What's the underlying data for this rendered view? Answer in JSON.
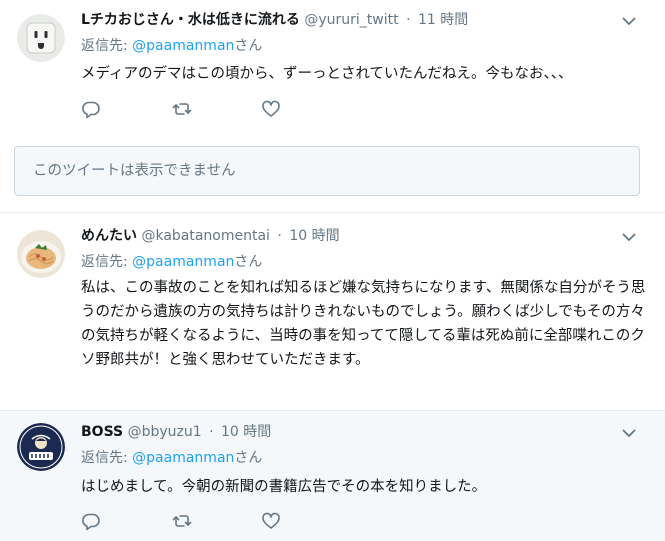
{
  "tweets": [
    {
      "name": "Lチカおじさん・水は低きに流れる",
      "handle": "@yururi_twitt",
      "dot": "·",
      "time": "11 時間",
      "reply_label": "返信先:",
      "reply_to": "@paamanman",
      "reply_suffix": "さん",
      "text": "メディアのデマはこの頃から、ずーっとされていたんだねえ。今もなお、、、",
      "avatar_icon": "outlet-avatar"
    },
    {
      "name": "めんたい",
      "handle": "@kabatanomentai",
      "dot": "·",
      "time": "10 時間",
      "reply_label": "返信先:",
      "reply_to": "@paamanman",
      "reply_suffix": "さん",
      "text": "私は、この事故のことを知れば知るほど嫌な気持ちになります、無関係な自分がそう思うのだから遺族の方の気持ちは計りきれないものでしょう。願わくば少しでもその方々の気持ちが軽くなるように、当時の事を知ってて隠してる輩は死ぬ前に全部喋れこのクソ野郎共が！と強く思わせていただきます。",
      "avatar_icon": "pasta-avatar"
    },
    {
      "name": "BOSS",
      "handle": "@bbyuzu1",
      "dot": "·",
      "time": "10 時間",
      "reply_label": "返信先:",
      "reply_to": "@paamanman",
      "reply_suffix": "さん",
      "text": "はじめまして。今朝の新聞の書籍広告でその本を知りました。",
      "avatar_icon": "boss-coffee-avatar"
    }
  ],
  "unavailable_notice": "このツイートは表示できません",
  "colors": {
    "link": "#1da1f2",
    "secondary": "#657786",
    "highlight_bg": "#f5f8fa",
    "border": "#e6ecf0"
  },
  "icons": [
    "reply-icon",
    "retweet-icon",
    "like-icon",
    "chevron-down-icon"
  ]
}
